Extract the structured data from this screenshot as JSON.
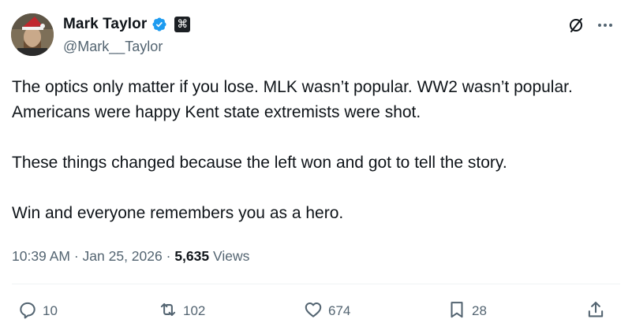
{
  "author": {
    "name": "Mark Taylor",
    "handle": "@Mark__Taylor",
    "verified_color": "#1d9bf0",
    "affiliation_badge_symbol": "⌘"
  },
  "tweet": {
    "paragraphs": [
      "The optics only matter if you lose. MLK wasn’t popular. WW2 wasn’t popular. Americans were happy Kent state extremists were shot.",
      "These things changed because the left won and got to tell the story.",
      "Win and everyone remembers you as a hero."
    ],
    "time": "10:39 AM",
    "separator": "·",
    "date": "Jan 25, 2026",
    "views_count": "5,635",
    "views_label": "Views"
  },
  "actions": {
    "replies": "10",
    "reposts": "102",
    "likes": "674",
    "bookmarks": "28"
  },
  "icons": {
    "reply": "reply-icon",
    "repost": "repost-icon",
    "like": "heart-icon",
    "bookmark": "bookmark-icon",
    "share": "share-icon",
    "grok": "grok-icon",
    "more": "more-icon"
  }
}
